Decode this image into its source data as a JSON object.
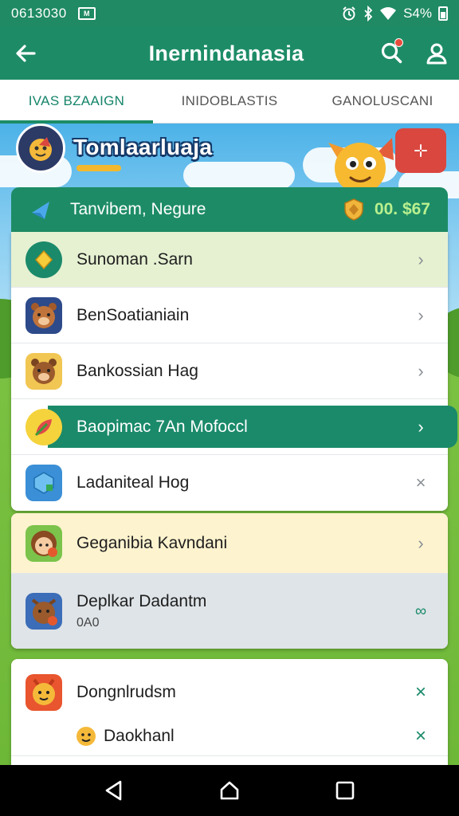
{
  "status_bar": {
    "time": "0613030",
    "sim": "M",
    "battery": "S4%"
  },
  "app_bar": {
    "title": "Inernindanasia"
  },
  "tabs": [
    {
      "label": "IVAS BZAAIGN",
      "active": true
    },
    {
      "label": "INIDOBLASTIS",
      "active": false
    },
    {
      "label": "GANOLUSCANI",
      "active": false
    }
  ],
  "banner": {
    "title": "Tomlaarluaja"
  },
  "section": {
    "label": "Tanvibem, Negure",
    "amount": "00. $67"
  },
  "card1": {
    "rows": [
      {
        "name": "Sunoman .Sarn",
        "trail": "chevron-right-icon",
        "style": "highlight"
      },
      {
        "name": "BenSoatianiain",
        "trail": "chevron-right-icon",
        "style": "normal"
      },
      {
        "name": "Bankossian Hag",
        "trail": "chevron-right-icon",
        "style": "normal"
      },
      {
        "name": "Baopimac 7An Mofoccl",
        "trail": "chevron-right-icon",
        "style": "active"
      },
      {
        "name": "Ladaniteal Hog",
        "trail": "close-icon",
        "style": "normal"
      }
    ]
  },
  "card2": {
    "rows": [
      {
        "name": "Geganibia Kavndani",
        "trail": "chevron-right-icon"
      },
      {
        "name": "Deplkar Dadantm",
        "sub": "0A0",
        "trail": "link-icon"
      }
    ]
  },
  "card3": {
    "rows": [
      {
        "name": "Dongnlrudsm",
        "trail": "close-icon"
      },
      {
        "name": "Daokhanl",
        "trail": "close-icon"
      }
    ]
  },
  "colors": {
    "primary": "#1d8c66",
    "accent_green": "#b9f08f",
    "banner_action": "#d9473f"
  }
}
